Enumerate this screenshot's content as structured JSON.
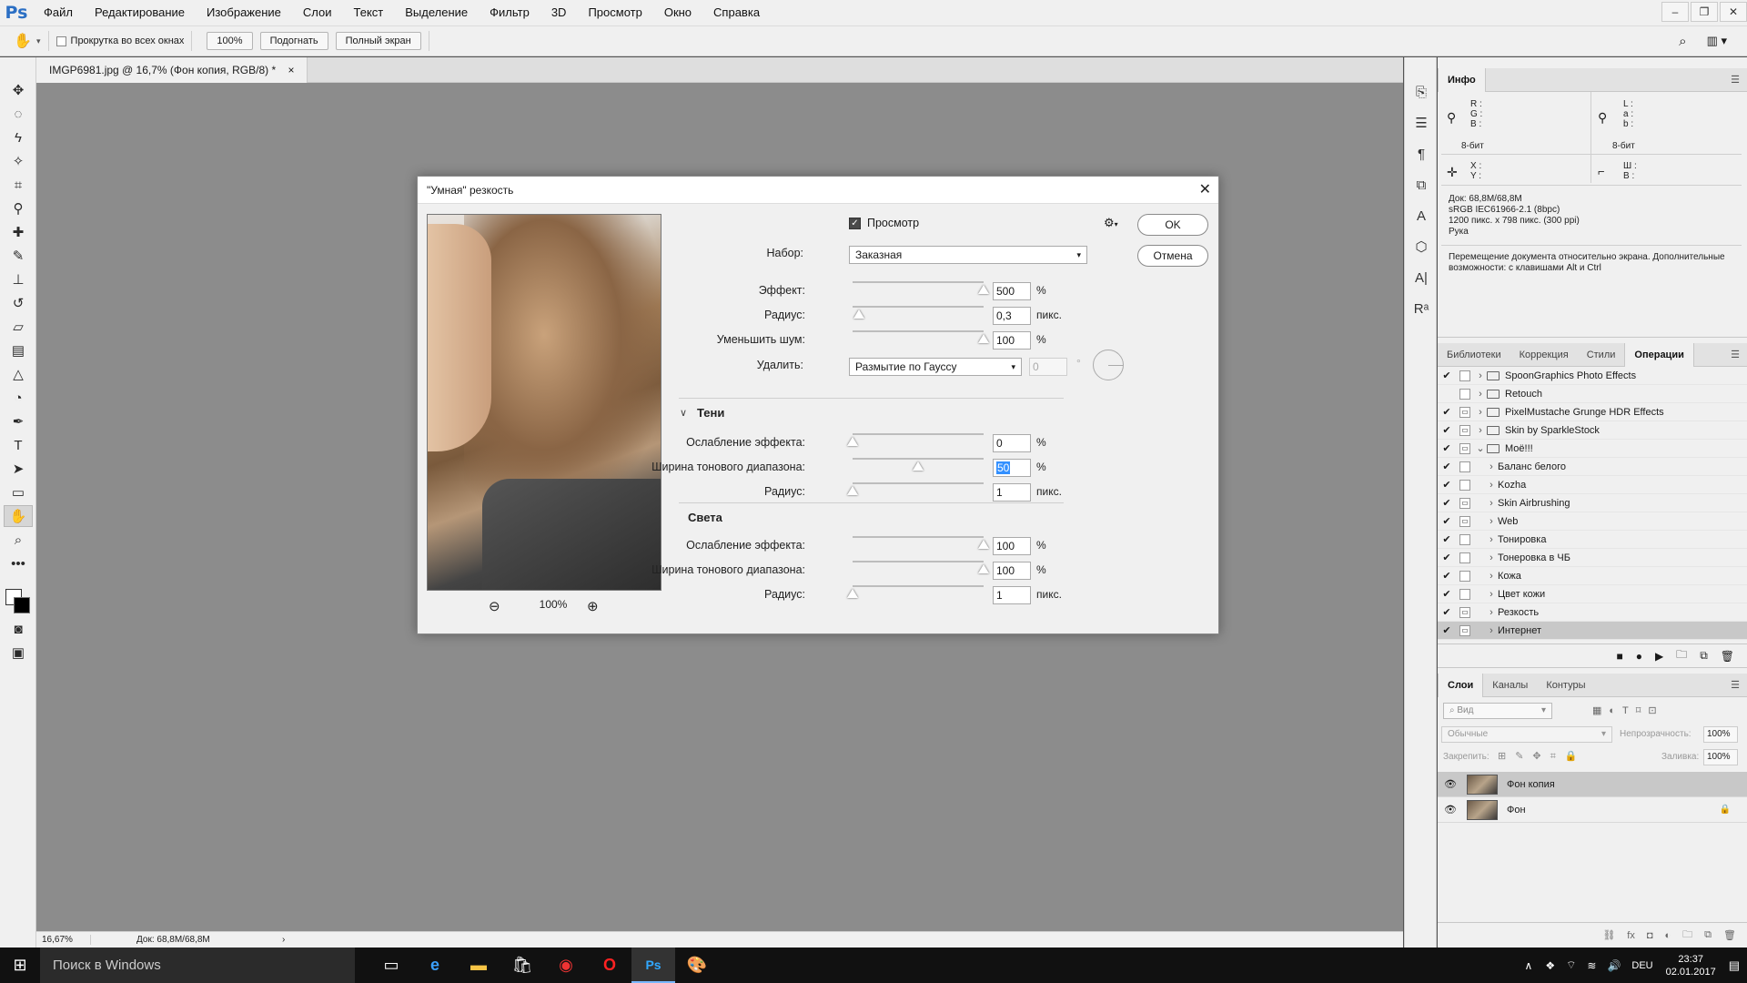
{
  "app": {
    "logo": "Ps"
  },
  "menu": [
    "Файл",
    "Редактирование",
    "Изображение",
    "Слои",
    "Текст",
    "Выделение",
    "Фильтр",
    "3D",
    "Просмотр",
    "Окно",
    "Справка"
  ],
  "window_controls": {
    "minimize": "–",
    "restore": "❐",
    "close": "✕"
  },
  "options_bar": {
    "scroll_all_label": "Прокрутка во всех окнах",
    "zoom_btn": "100%",
    "fit_btn": "Подогнать",
    "fullscreen_btn": "Полный экран"
  },
  "document": {
    "tab_title": "IMGP6981.jpg @ 16,7% (Фон копия, RGB/8) *",
    "tab_close": "×",
    "status_zoom": "16,67%",
    "status_doc": "Док: 68,8M/68,8M",
    "status_arrow": "›"
  },
  "info_panel": {
    "tab": "Инфо",
    "rgb_labels": [
      "R :",
      "G :",
      "B :"
    ],
    "lab_labels": [
      "L :",
      "a :",
      "b :"
    ],
    "bit_left": "8-бит",
    "bit_right": "8-бит",
    "xy_labels": [
      "X :",
      "Y :"
    ],
    "wh_labels": [
      "Ш :",
      "В :"
    ],
    "doc_lines": [
      "Док: 68,8M/68,8M",
      "sRGB IEC61966-2.1 (8bpc)",
      "1200 пикс. x 798 пикс. (300 ppi)",
      "Рука"
    ],
    "hint": "Перемещение документа относительно экрана. Дополнительные возможности: с клавишами Alt и Ctrl"
  },
  "actions_panel": {
    "tabs": [
      "Библиотеки",
      "Коррекция",
      "Стили",
      "Операции"
    ],
    "active_tab": "Операции",
    "rows": [
      {
        "label": "SpoonGraphics Photo Effects",
        "check": "✔",
        "box": "",
        "level": 0,
        "folder": true,
        "expanded": false
      },
      {
        "label": "Retouch",
        "check": "",
        "box": "",
        "level": 0,
        "folder": true,
        "expanded": false
      },
      {
        "label": "PixelMustache Grunge HDR Effects",
        "check": "✔",
        "box": "▭",
        "level": 0,
        "folder": true,
        "expanded": false
      },
      {
        "label": "Skin by SparkleStock",
        "check": "✔",
        "box": "▭",
        "level": 0,
        "folder": true,
        "expanded": false
      },
      {
        "label": "Моё!!!",
        "check": "✔",
        "box": "▭",
        "level": 0,
        "folder": true,
        "expanded": true
      },
      {
        "label": "Баланс белого",
        "check": "✔",
        "box": "",
        "level": 1,
        "folder": false
      },
      {
        "label": "Kozha",
        "check": "✔",
        "box": "",
        "level": 1,
        "folder": false
      },
      {
        "label": "Skin Airbrushing",
        "check": "✔",
        "box": "▭",
        "level": 1,
        "folder": false
      },
      {
        "label": "Web",
        "check": "✔",
        "box": "▭",
        "level": 1,
        "folder": false
      },
      {
        "label": "Тонировка",
        "check": "✔",
        "box": "",
        "level": 1,
        "folder": false
      },
      {
        "label": "Тонеровка в ЧБ",
        "check": "✔",
        "box": "",
        "level": 1,
        "folder": false
      },
      {
        "label": "Кожа",
        "check": "✔",
        "box": "",
        "level": 1,
        "folder": false
      },
      {
        "label": "Цвет кожи",
        "check": "✔",
        "box": "",
        "level": 1,
        "folder": false
      },
      {
        "label": "Резкость",
        "check": "✔",
        "box": "▭",
        "level": 1,
        "folder": false
      },
      {
        "label": "Интернет",
        "check": "✔",
        "box": "▭",
        "level": 1,
        "folder": false,
        "selected": true
      }
    ],
    "footer_icons": [
      "■",
      "●",
      "▶",
      "🗀",
      "⧉",
      "🗑"
    ]
  },
  "layers_panel": {
    "tabs": [
      "Слои",
      "Каналы",
      "Контуры"
    ],
    "active_tab": "Слои",
    "search_placeholder": "Вид",
    "blend_mode": "Обычные",
    "opacity_label": "Непрозрачность:",
    "opacity_value": "100%",
    "lock_label": "Закрепить:",
    "fill_label": "Заливка:",
    "fill_value": "100%",
    "layers": [
      {
        "name": "Фон копия",
        "selected": true,
        "locked": false
      },
      {
        "name": "Фон",
        "selected": false,
        "locked": true
      }
    ],
    "footer_icons": [
      "⛓",
      "fx",
      "◘",
      "◐",
      "🗀",
      "⧉",
      "🗑"
    ]
  },
  "dialog": {
    "title": "\"Умная\" резкость",
    "close": "✕",
    "preview_label": "Просмотр",
    "preset_label": "Набор:",
    "preset_value": "Заказная",
    "ok": "OK",
    "cancel": "Отмена",
    "zoom_value": "100%",
    "main": [
      {
        "label": "Эффект:",
        "value": "500",
        "unit": "%",
        "pos": 1.0
      },
      {
        "label": "Радиус:",
        "value": "0,3",
        "unit": "пикс.",
        "pos": 0.05
      },
      {
        "label": "Уменьшить шум:",
        "value": "100",
        "unit": "%",
        "pos": 1.0
      }
    ],
    "remove_label": "Удалить:",
    "remove_value": "Размытие по Гауссу",
    "angle_value": "0",
    "angle_unit": "°",
    "shadows_title": "Тени",
    "shadows": [
      {
        "label": "Ослабление эффекта:",
        "value": "0",
        "unit": "%",
        "pos": 0.0
      },
      {
        "label": "Ширина тонового диапазона:",
        "value": "50",
        "unit": "%",
        "pos": 0.5,
        "selected": true
      },
      {
        "label": "Радиус:",
        "value": "1",
        "unit": "пикс.",
        "pos": 0.0
      }
    ],
    "highlights_title": "Света",
    "highlights": [
      {
        "label": "Ослабление эффекта:",
        "value": "100",
        "unit": "%",
        "pos": 1.0
      },
      {
        "label": "Ширина тонового диапазона:",
        "value": "100",
        "unit": "%",
        "pos": 1.0
      },
      {
        "label": "Радиус:",
        "value": "1",
        "unit": "пикс.",
        "pos": 0.0
      }
    ]
  },
  "taskbar": {
    "search_placeholder": "Поиск в Windows",
    "lang": "DEU",
    "time": "23:37",
    "date": "02.01.2017"
  }
}
